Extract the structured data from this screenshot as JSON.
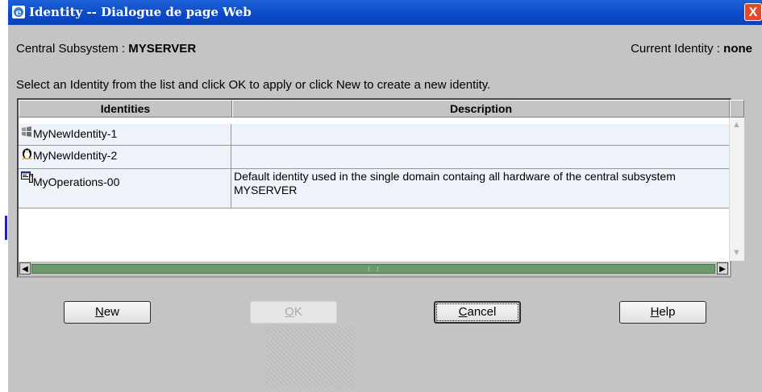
{
  "window": {
    "title": "Identity -- Dialogue de page Web",
    "close_label": "X"
  },
  "header": {
    "subsystem_label": "Central Subsystem :",
    "subsystem_value": "MYSERVER",
    "identity_label": "Current Identity :",
    "identity_value": "none"
  },
  "instruction": "Select an Identity from the list and click OK to apply or click New to create a new identity.",
  "table": {
    "columns": [
      "Identities",
      "Description"
    ],
    "rows": [
      {
        "name": "MyNewIdentity-1",
        "icon": "windows-flag-icon",
        "description": ""
      },
      {
        "name": "MyNewIdentity-2",
        "icon": "linux-penguin-icon",
        "description": ""
      },
      {
        "name": "MyOperations-00",
        "icon": "server-window-icon",
        "description": "Default identity used in the single domain containg all hardware of the central subsystem MYSERVER"
      }
    ]
  },
  "buttons": {
    "new": {
      "label_key": "N",
      "label_rest": "ew"
    },
    "ok": {
      "label_key": "O",
      "label_rest": "K"
    },
    "cancel": {
      "label_key": "C",
      "label_rest": "ancel"
    },
    "help": {
      "label_key": "H",
      "label_rest": "elp"
    }
  },
  "colors": {
    "titlebar": "#0a48c8",
    "dialog_bg": "#c4c4c4",
    "row_bg": "#eef3fa",
    "scroll_thumb": "#6c9a6c"
  }
}
